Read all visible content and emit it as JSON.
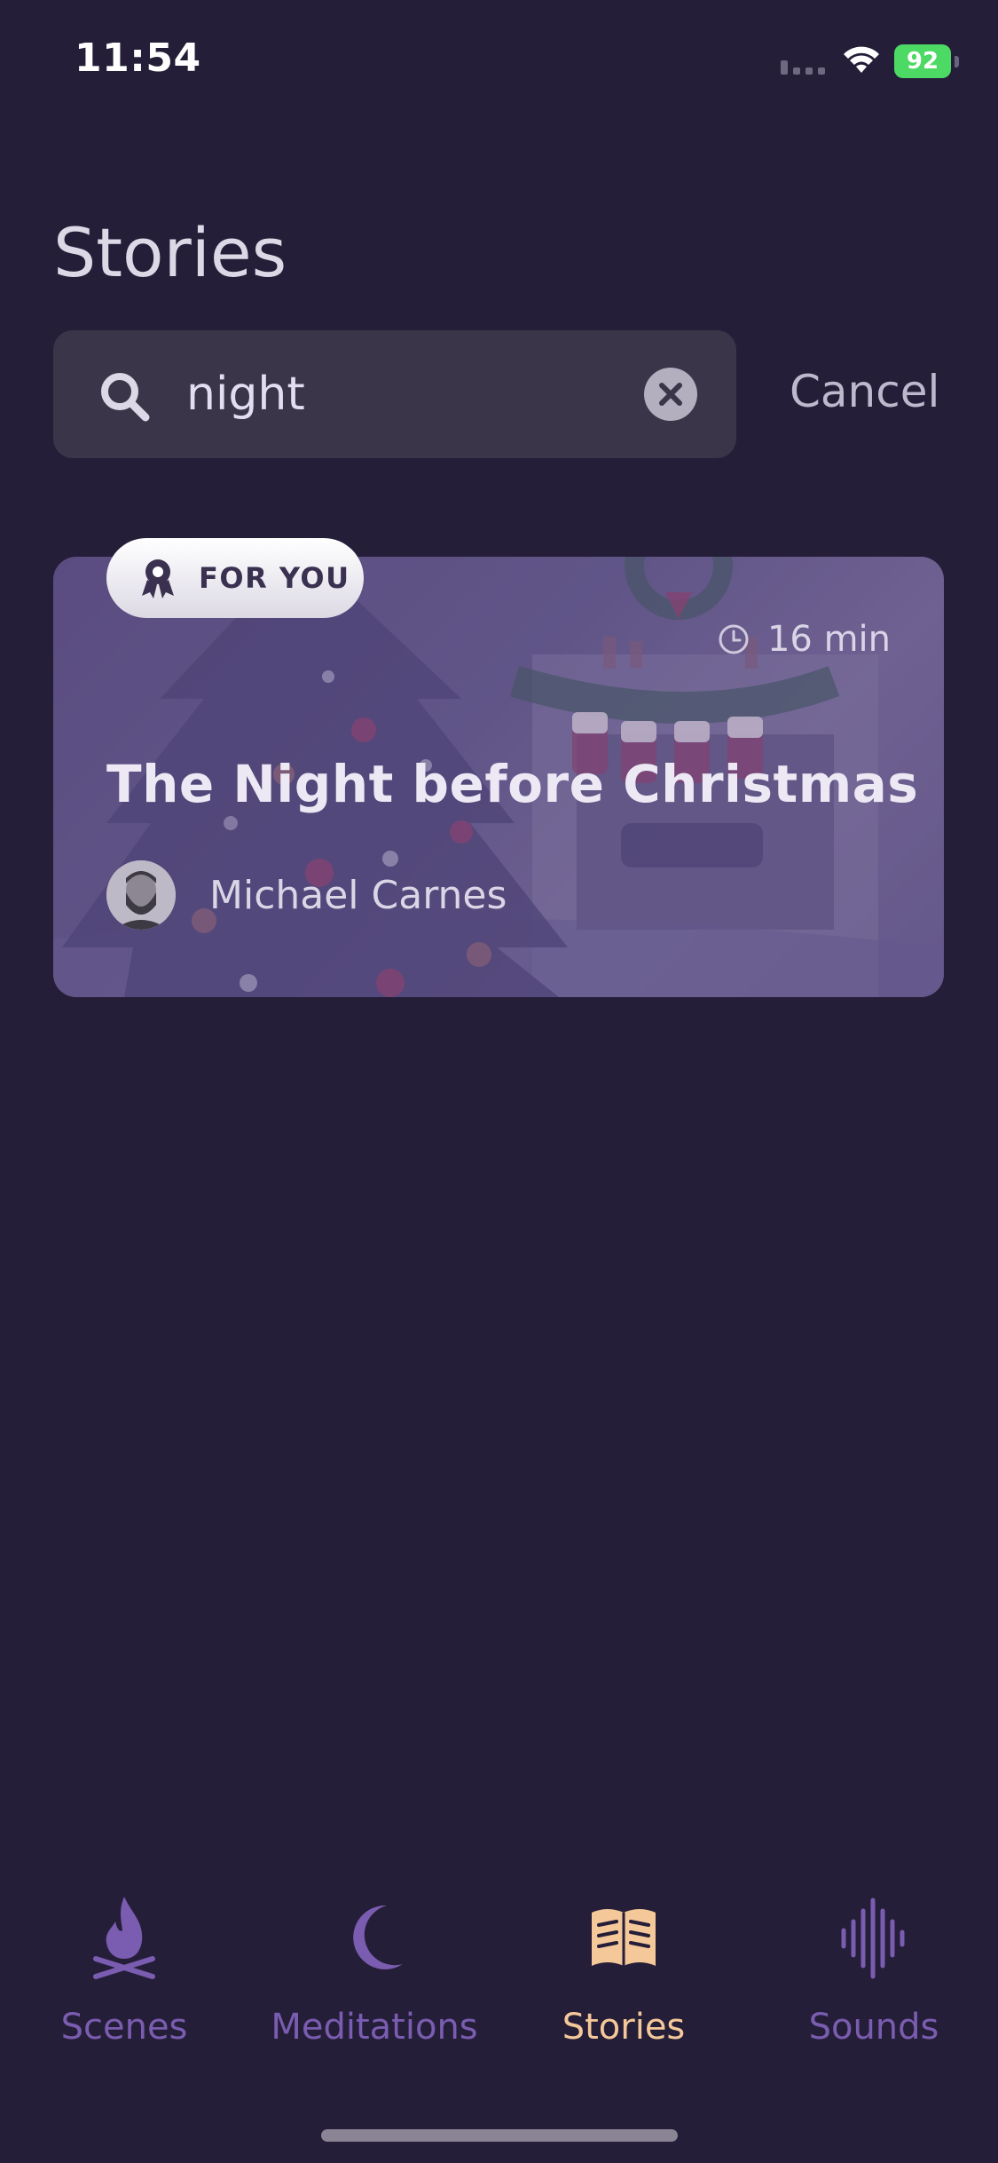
{
  "status_bar": {
    "time": "11:54",
    "battery": "92"
  },
  "header": {
    "title": "Stories"
  },
  "search": {
    "value": "night",
    "cancel_label": "Cancel"
  },
  "results": [
    {
      "badge": "FOR YOU",
      "duration": "16 min",
      "title": "The Night before Christmas",
      "author": "Michael Carnes"
    }
  ],
  "tab_bar": {
    "items": [
      {
        "label": "Scenes",
        "icon": "campfire-icon"
      },
      {
        "label": "Meditations",
        "icon": "moon-icon"
      },
      {
        "label": "Stories",
        "icon": "open-book-icon",
        "active": true
      },
      {
        "label": "Sounds",
        "icon": "sound-wave-icon"
      }
    ]
  },
  "colors": {
    "background": "#251e38",
    "accent_active": "#f5c89a",
    "accent_inactive": "#7a5cb0",
    "battery": "#4cd964"
  }
}
